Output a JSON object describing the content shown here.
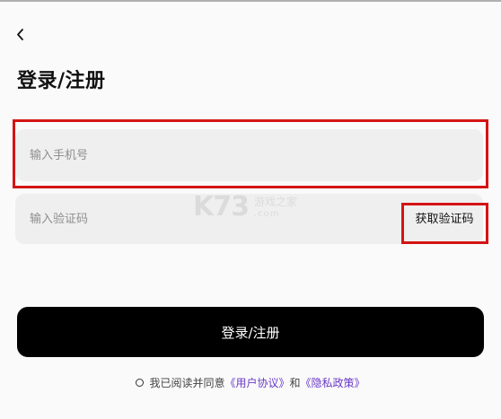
{
  "header": {
    "back_icon": "chevron-left-icon",
    "title": "登录/注册"
  },
  "form": {
    "phone_placeholder": "输入手机号",
    "code_placeholder": "输入验证码",
    "get_code_label": "获取验证码",
    "submit_label": "登录/注册"
  },
  "watermark": {
    "brand": "K73",
    "name": "游戏之家",
    "domain": ".com"
  },
  "agreement": {
    "prefix": "我已阅读并同意",
    "user_agreement": "《用户协议》",
    "and": "和",
    "privacy_policy": "《隐私政策》"
  },
  "colors": {
    "highlight": "#d41414",
    "link": "#6a39c8",
    "button": "#000000"
  }
}
